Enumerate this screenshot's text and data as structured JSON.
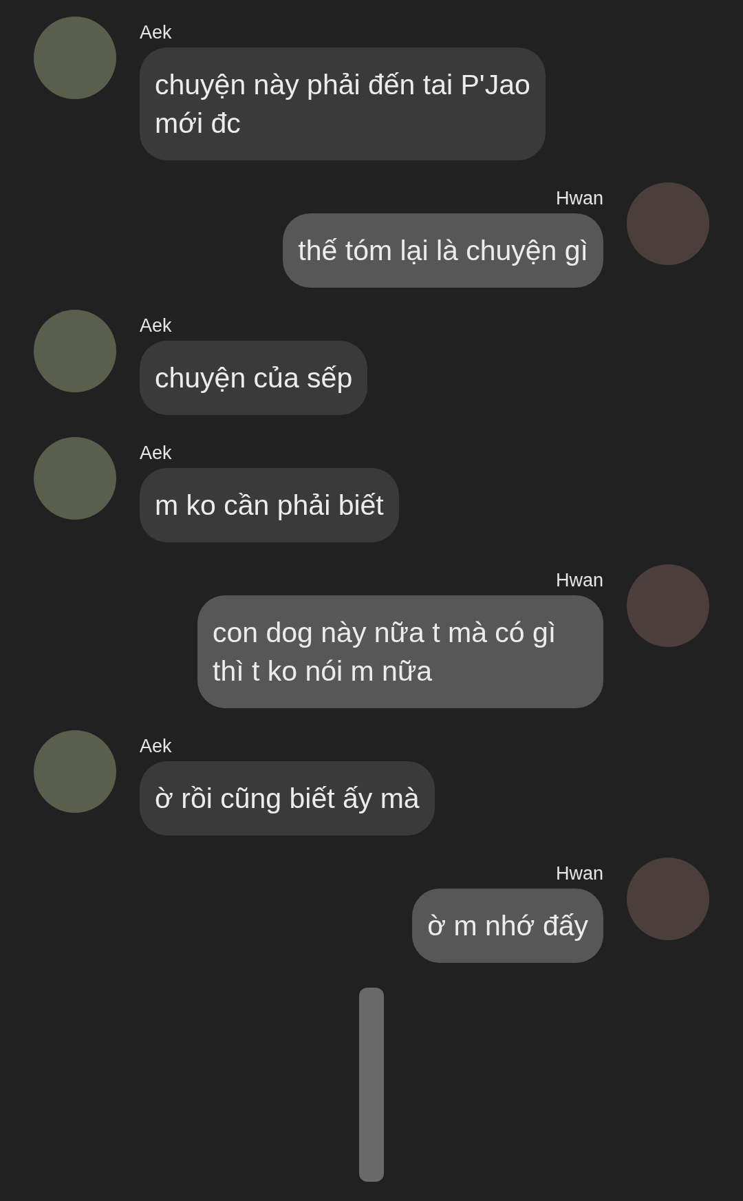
{
  "messages": [
    {
      "kind": "received",
      "sender": "Aek",
      "text": "chuyện này phải đến tai P'Jao mới đc"
    },
    {
      "kind": "sent",
      "sender": "Hwan",
      "text": "thế tóm lại là chuyện gì"
    },
    {
      "kind": "received",
      "sender": "Aek",
      "text": "chuyện của sếp"
    },
    {
      "kind": "received",
      "sender": "Aek",
      "text": "m ko cần phải biết"
    },
    {
      "kind": "sent",
      "sender": "Hwan",
      "text": "con dog này nữa t mà có gì thì t ko nói m nữa"
    },
    {
      "kind": "received",
      "sender": "Aek",
      "text": "ờ rồi cũng biết ấy mà"
    },
    {
      "kind": "sent",
      "sender": "Hwan",
      "text": "ờ m nhớ đấy"
    }
  ]
}
